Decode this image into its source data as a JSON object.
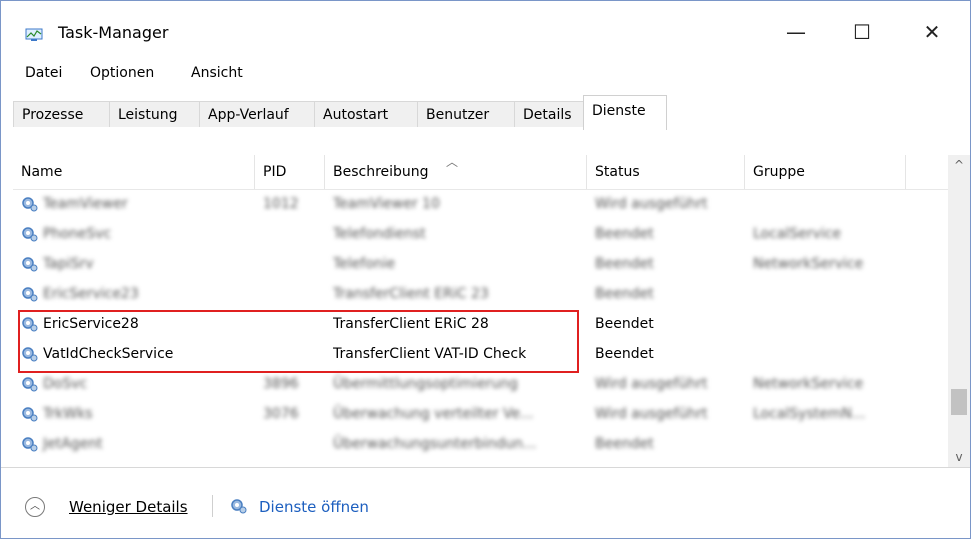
{
  "window": {
    "title": "Task-Manager",
    "minimize_label": "—",
    "maximize_label": "☐",
    "close_label": "✕"
  },
  "menu": [
    "Datei",
    "Optionen",
    "Ansicht"
  ],
  "tabs": [
    "Prozesse",
    "Leistung",
    "App-Verlauf",
    "Autostart",
    "Benutzer",
    "Details",
    "Dienste"
  ],
  "active_tab": "Dienste",
  "columns": {
    "name": "Name",
    "pid": "PID",
    "description": "Beschreibung",
    "status": "Status",
    "group": "Gruppe"
  },
  "rows": [
    {
      "name": "TeamViewer",
      "pid": "1012",
      "description": "TeamViewer 10",
      "status": "Wird ausgeführt",
      "group": "",
      "blurred": true
    },
    {
      "name": "PhoneSvc",
      "pid": "",
      "description": "Telefondienst",
      "status": "Beendet",
      "group": "LocalService",
      "blurred": true
    },
    {
      "name": "TapiSrv",
      "pid": "",
      "description": "Telefonie",
      "status": "Beendet",
      "group": "NetworkService",
      "blurred": true
    },
    {
      "name": "EricService23",
      "pid": "",
      "description": "TransferClient ERiC 23",
      "status": "Beendet",
      "group": "",
      "blurred": true
    },
    {
      "name": "EricService28",
      "pid": "",
      "description": "TransferClient ERiC 28",
      "status": "Beendet",
      "group": "",
      "blurred": false
    },
    {
      "name": "VatIdCheckService",
      "pid": "",
      "description": "TransferClient VAT-ID Check",
      "status": "Beendet",
      "group": "",
      "blurred": false
    },
    {
      "name": "DoSvc",
      "pid": "3896",
      "description": "Übermittlungsoptimierung",
      "status": "Wird ausgeführt",
      "group": "NetworkService",
      "blurred": true
    },
    {
      "name": "TrkWks",
      "pid": "3076",
      "description": "Überwachung verteilter Ve...",
      "status": "Wird ausgeführt",
      "group": "LocalSystemN...",
      "blurred": true
    },
    {
      "name": "JetAgent",
      "pid": "",
      "description": "Überwachungsunterbindun...",
      "status": "Beendet",
      "group": "",
      "blurred": true
    }
  ],
  "footer": {
    "less_details": "Weniger Details",
    "open_services": "Dienste öffnen"
  },
  "scrollbar": {
    "up_arrow": "^",
    "down_arrow": "v",
    "position_fraction": 0.87
  },
  "colors": {
    "highlight": "#e02020",
    "link": "#1d5fbf",
    "icon_blue": "#4a7fc1"
  }
}
